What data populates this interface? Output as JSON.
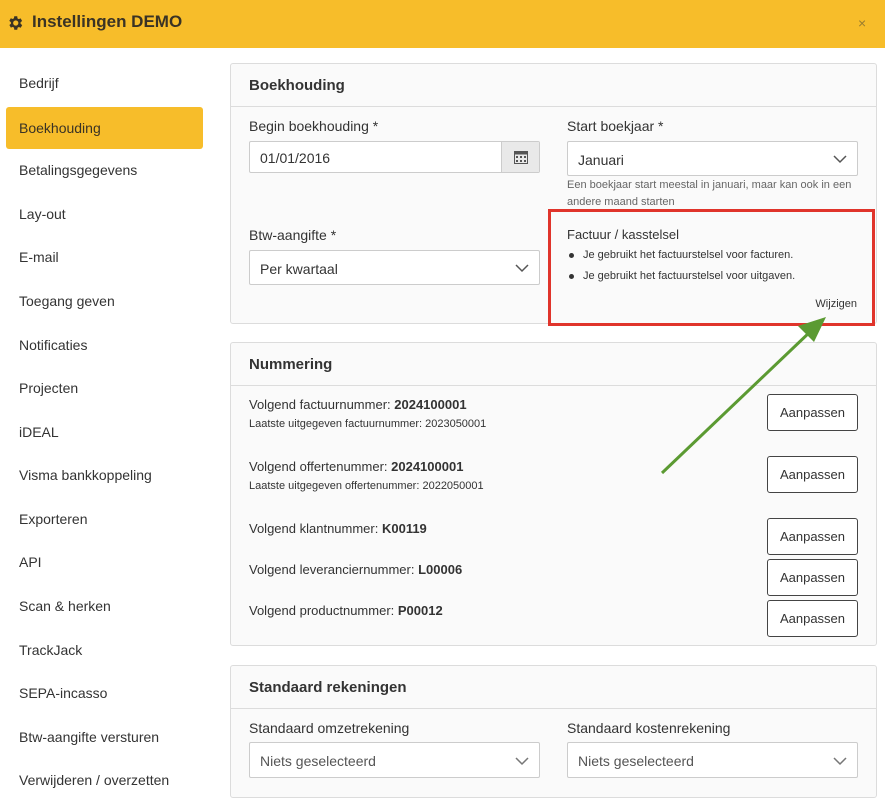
{
  "window": {
    "title": "Instellingen DEMO",
    "close_glyph": "×"
  },
  "sidebar": {
    "items": [
      {
        "label": "Bedrijf"
      },
      {
        "label": "Boekhouding"
      },
      {
        "label": "Betalingsgegevens"
      },
      {
        "label": "Lay-out"
      },
      {
        "label": "E-mail"
      },
      {
        "label": "Toegang geven"
      },
      {
        "label": "Notificaties"
      },
      {
        "label": "Projecten"
      },
      {
        "label": "iDEAL"
      },
      {
        "label": "Visma bankkoppeling"
      },
      {
        "label": "Exporteren"
      },
      {
        "label": "API"
      },
      {
        "label": "Scan & herken"
      },
      {
        "label": "TrackJack"
      },
      {
        "label": "SEPA-incasso"
      },
      {
        "label": "Btw-aangifte versturen"
      },
      {
        "label": "Verwijderen / overzetten"
      }
    ],
    "active_index": 1
  },
  "boekhouding": {
    "title": "Boekhouding",
    "begin_label": "Begin boekhouding *",
    "begin_value": "01/01/2016",
    "start_label": "Start boekjaar *",
    "start_value": "Januari",
    "start_help": "Een boekjaar start meestal in januari, maar kan ook in een andere maand starten",
    "btw_label": "Btw-aangifte *",
    "btw_value": "Per kwartaal",
    "stelsel_title": "Factuur / kasstelsel",
    "stelsel_items": [
      "Je gebruikt het factuurstelsel voor facturen.",
      "Je gebruikt het factuurstelsel voor uitgaven."
    ],
    "stelsel_link": "Wijzigen"
  },
  "nummering": {
    "title": "Nummering",
    "button_label": "Aanpassen",
    "rows": [
      {
        "label": "Volgend factuurnummer: ",
        "value": "2024100001",
        "sub": "Laatste uitgegeven factuurnummer: 2023050001"
      },
      {
        "label": "Volgend offertenummer: ",
        "value": "2024100001",
        "sub": "Laatste uitgegeven offertenummer: 2022050001"
      },
      {
        "label": "Volgend klantnummer: ",
        "value": "K00119"
      },
      {
        "label": "Volgend leveranciernummer: ",
        "value": "L00006"
      },
      {
        "label": "Volgend productnummer: ",
        "value": "P00012"
      }
    ]
  },
  "rekeningen": {
    "title": "Standaard rekeningen",
    "omzet_label": "Standaard omzetrekening",
    "omzet_placeholder": "Niets geselecteerd",
    "kosten_label": "Standaard kostenrekening",
    "kosten_placeholder": "Niets geselecteerd"
  },
  "colors": {
    "accent": "#f7bd2a",
    "highlight_border": "#e0342b",
    "annotation_arrow": "#5b9a32"
  },
  "icons": [
    "gear-icon",
    "close-icon",
    "calendar-icon",
    "chevron-down-icon",
    "annotation-arrow"
  ]
}
